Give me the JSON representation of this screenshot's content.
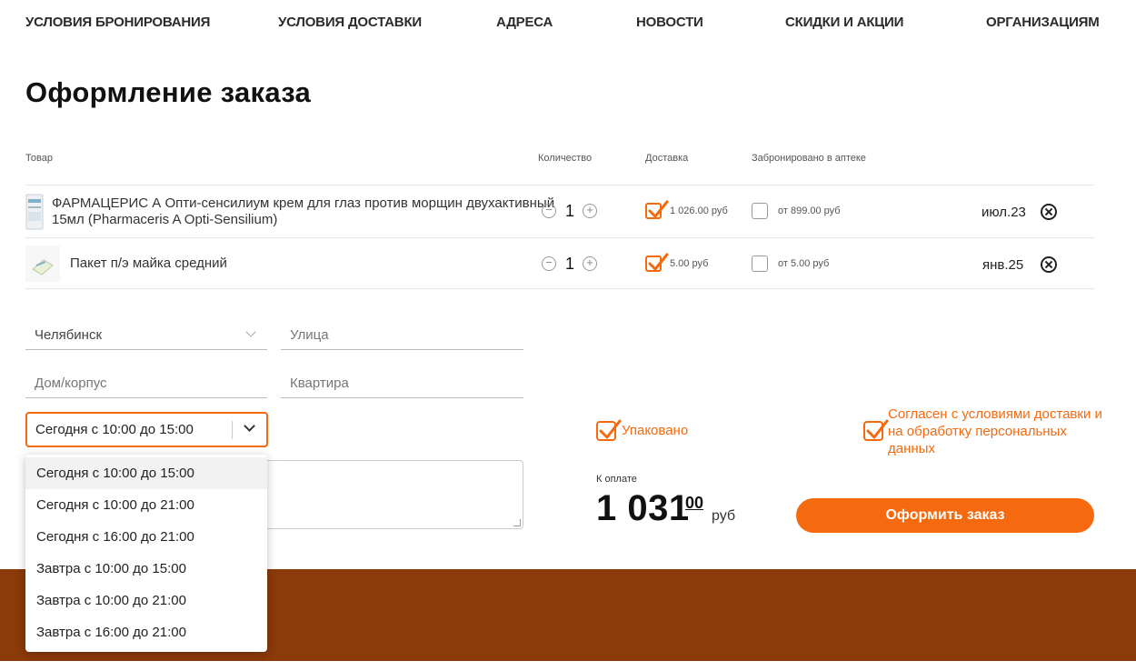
{
  "nav": [
    "Условия бронирования",
    "Условия доставки",
    "Адреса",
    "Новости",
    "Скидки и акции",
    "Организациям"
  ],
  "page_title": "Оформление заказа",
  "table": {
    "headers": {
      "product": "Товар",
      "quantity": "Количество",
      "delivery": "Доставка",
      "reserved": "Забронировано в аптеке"
    },
    "rows": [
      {
        "name_line1": "ФАРМАЦЕРИС А Опти-сенсилиум крем для глаз против морщин двухактивный",
        "name_line2": "15мл (Pharmaceris A Opti-Sensilium)",
        "qty": "1",
        "delivery_price": "1 026.00 руб",
        "delivery_checked": true,
        "reserve_price": "от 899.00 руб",
        "reserve_checked": false,
        "date": "июл.23"
      },
      {
        "name_line1": "Пакет п/э майка средний",
        "qty": "1",
        "delivery_price": "5.00 руб",
        "delivery_checked": true,
        "reserve_price": "от 5.00 руб",
        "reserve_checked": false,
        "date": "янв.25"
      }
    ],
    "qty_minus": "−",
    "qty_plus": "+"
  },
  "form": {
    "city": "Челябинск",
    "street_placeholder": "Улица",
    "house_placeholder": "Дом/корпус",
    "apt_placeholder": "Квартира",
    "time_selected": "Сегодня с 10:00 до 15:00",
    "time_options": [
      "Сегодня с 10:00 до 15:00",
      "Сегодня с 10:00 до 21:00",
      "Сегодня с 16:00 до 21:00",
      "Завтра с 10:00 до 15:00",
      "Завтра с 10:00 до 21:00",
      "Завтра с 16:00 до 21:00"
    ]
  },
  "checks": {
    "packed": "Упаковано",
    "agree_line1": "Согласен с условиями доставки и",
    "agree_line2": "на обработку персональных",
    "agree_line3": "данных"
  },
  "total": {
    "label": "К оплате",
    "integer": "1 031",
    "decimal": "00",
    "currency": "руб"
  },
  "order_button": "Оформить заказ",
  "colors": {
    "accent": "#f56a0f",
    "footer": "#8b3a09"
  }
}
